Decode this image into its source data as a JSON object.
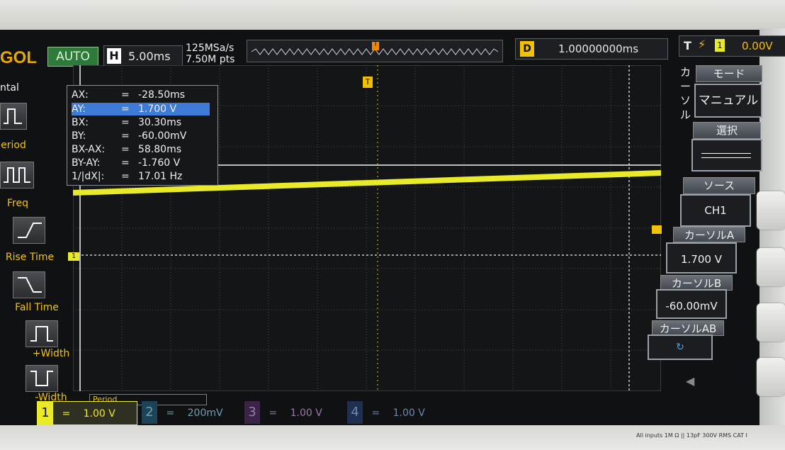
{
  "header": {
    "brand": "GOL",
    "run_mode": "AUTO",
    "timebase_label": "H",
    "timebase_value": "5.00ms",
    "sample_rate": "125MSa/s",
    "memory_depth": "7.50M pts",
    "trigger_marker": "T",
    "delay_label": "D",
    "delay_value": "1.00000000ms",
    "trigger_label": "T",
    "trigger_source": "1",
    "trigger_level": "0.00V"
  },
  "cursor_readout": {
    "rows": [
      {
        "key": "AX:",
        "value": "-28.50ms"
      },
      {
        "key": "AY:",
        "value": "1.700 V"
      },
      {
        "key": "BX:",
        "value": "30.30ms"
      },
      {
        "key": "BY:",
        "value": "-60.00mV"
      },
      {
        "key": "BX-AX:",
        "value": "58.80ms"
      },
      {
        "key": "BY-AY:",
        "value": "-1.760 V"
      },
      {
        "key": "1/|dX|:",
        "value": "17.01 Hz"
      }
    ],
    "eq": "="
  },
  "left_menu": {
    "header": "ntal",
    "items": [
      "eriod",
      "Freq",
      "Rise Time",
      "Fall Time",
      "+Width",
      "-Width"
    ]
  },
  "right_menu": {
    "side_label": "カーソル",
    "mode_title": "モード",
    "mode_value": "マニュアル",
    "select_title": "選択",
    "source_title": "ソース",
    "source_value": "CH1",
    "cursor_a_title": "カーソルA",
    "cursor_a_value": "1.700 V",
    "cursor_b_title": "カーソルB",
    "cursor_b_value": "-60.00mV",
    "cursor_ab_title": "カーソルAB"
  },
  "bottom_bar": {
    "period_label": "Period",
    "ch1_num": "1",
    "ch1_value": "1.00 V",
    "ch2_num": "2",
    "ch2_value": "200mV",
    "ch3_num": "3",
    "ch3_value": "1.00 V",
    "ch4_num": "4",
    "ch4_value": "1.00 V",
    "coupling": "="
  },
  "channel_marker": "1",
  "front_panel": "All inputs 1M Ω || 13pF 300V RMS CAT I",
  "colors": {
    "ch1": "#e9ea2a",
    "cursor": "#f4f4f4",
    "accent": "#f2c200",
    "selected_row": "#3e7bd6",
    "ch2": "#2fa6d6",
    "ch3": "#b04fd0",
    "ch4": "#3a6fd8"
  },
  "icons": [
    "period-icon",
    "freq-icon",
    "rise-time-icon",
    "fall-time-icon",
    "pos-width-icon",
    "neg-width-icon",
    "speaker-icon"
  ]
}
